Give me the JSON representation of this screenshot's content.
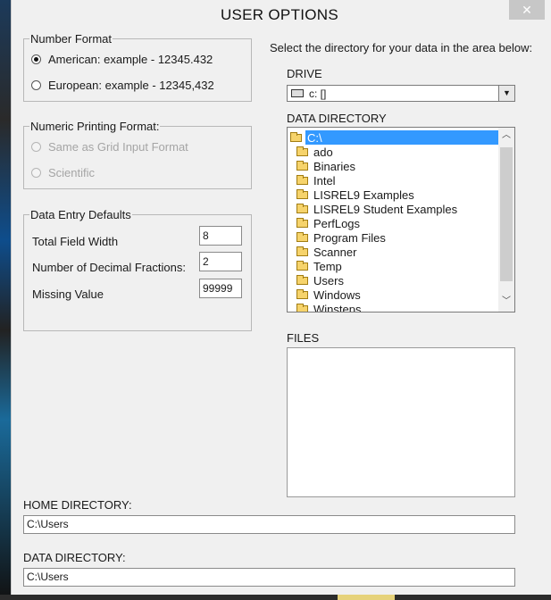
{
  "dialog": {
    "title": "USER OPTIONS",
    "close_symbol": "✕"
  },
  "number_format": {
    "legend": "Number Format",
    "options": [
      {
        "label": "American: example - 12345.432",
        "selected": true
      },
      {
        "label": "European: example - 12345,432",
        "selected": false
      }
    ]
  },
  "numeric_printing": {
    "legend": "Numeric Printing Format:",
    "options": [
      {
        "label": "Same as Grid Input Format",
        "enabled": false
      },
      {
        "label": "Scientific",
        "enabled": false
      }
    ]
  },
  "data_entry": {
    "legend": "Data Entry Defaults",
    "total_field_width_label": "Total Field Width",
    "total_field_width": "8",
    "decimal_fractions_label": "Number of Decimal Fractions:",
    "decimal_fractions": "2",
    "missing_value_label": "Missing Value",
    "missing_value": "99999"
  },
  "directory_panel": {
    "instruction": "Select the directory for your data in the area below:",
    "drive_label": "DRIVE",
    "drive_value": "c: []",
    "data_directory_label": "DATA DIRECTORY",
    "directories": [
      "C:\\",
      "ado",
      "Binaries",
      "Intel",
      "LISREL9 Examples",
      "LISREL9 Student Examples",
      "PerfLogs",
      "Program Files",
      "Scanner",
      "Temp",
      "Users",
      "Windows",
      "Winsteps"
    ],
    "files_label": "FILES"
  },
  "home_directory": {
    "label": "HOME DIRECTORY:",
    "value": "C:\\Users"
  },
  "data_directory": {
    "label": "DATA DIRECTORY:",
    "value": "C:\\Users"
  },
  "icons": {
    "drive": "drive-icon",
    "folder": "folder-icon",
    "open_folder": "open-folder-icon"
  },
  "colors": {
    "selection": "#3399ff",
    "folder": "#f6d36b"
  }
}
